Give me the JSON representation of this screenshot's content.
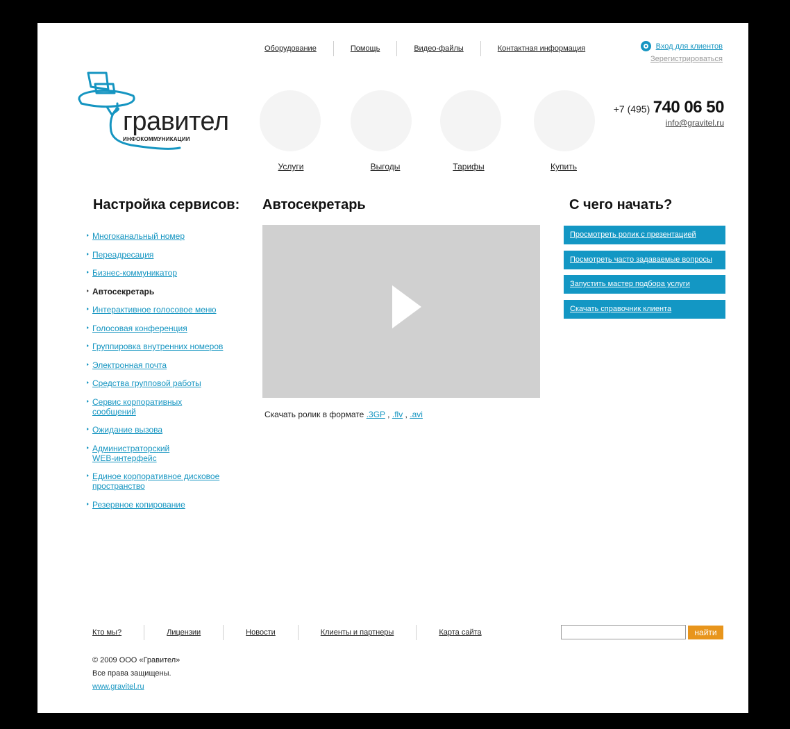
{
  "topnav": [
    "Оборудование",
    "Помощь",
    "Видео-файлы",
    "Контактная информация"
  ],
  "login": {
    "enter": "Вход для клиентов",
    "register": "Зерегистрироваться"
  },
  "logo": {
    "name": "гравител",
    "tagline": "ИНФОКОММУНИКАЦИИ"
  },
  "promo": [
    "Услуги",
    "Выгоды",
    "Тарифы",
    "Купить"
  ],
  "contact": {
    "prefix": "+7 (495)",
    "number": "740 06 50",
    "email": "info@gravitel.ru"
  },
  "headings": {
    "services": "Настройка сервисов:",
    "current": "Автосекретарь",
    "start": "С чего начать?"
  },
  "menu": [
    "Многоканальный номер",
    "Переадресация",
    "Бизнес-коммуникатор",
    "Автосекретарь",
    "Интерактивное голосовое меню",
    "Голосовая конференция",
    "Группировка внутренних номеров",
    "Электронная почта",
    "Средства групповой работы",
    "Сервис корпоративных сообщений",
    "Ожидание вызова",
    "Администраторский WEB-интерфейс",
    "Единое корпоративное дисковое пространство",
    "Резервное копирование"
  ],
  "menu_active_index": 3,
  "video": {
    "download_prefix": "Скачать ролик в формате",
    "formats": [
      ".3GP",
      ".flv",
      ".avi"
    ],
    "comma": ","
  },
  "start_actions": [
    "Просмотреть ролик с презентацией",
    "Посмотреть часто задаваемые вопросы",
    "Запустить мастер подбора услуги",
    "Скачать справочник клиента"
  ],
  "footer_nav": [
    "Кто мы?",
    "Лицензии",
    "Новости",
    "Клиенты и партнеры",
    "Карта сайта"
  ],
  "search": {
    "value": "",
    "button": "найти"
  },
  "copyright": {
    "line1": "© 2009 ООО «Гравител»",
    "line2": "Все права защищены.",
    "site": "www.gravitel.ru"
  },
  "colors": {
    "accent": "#1595c1",
    "button_orange": "#e8951c",
    "placeholder_gray": "#d0d0d0"
  }
}
